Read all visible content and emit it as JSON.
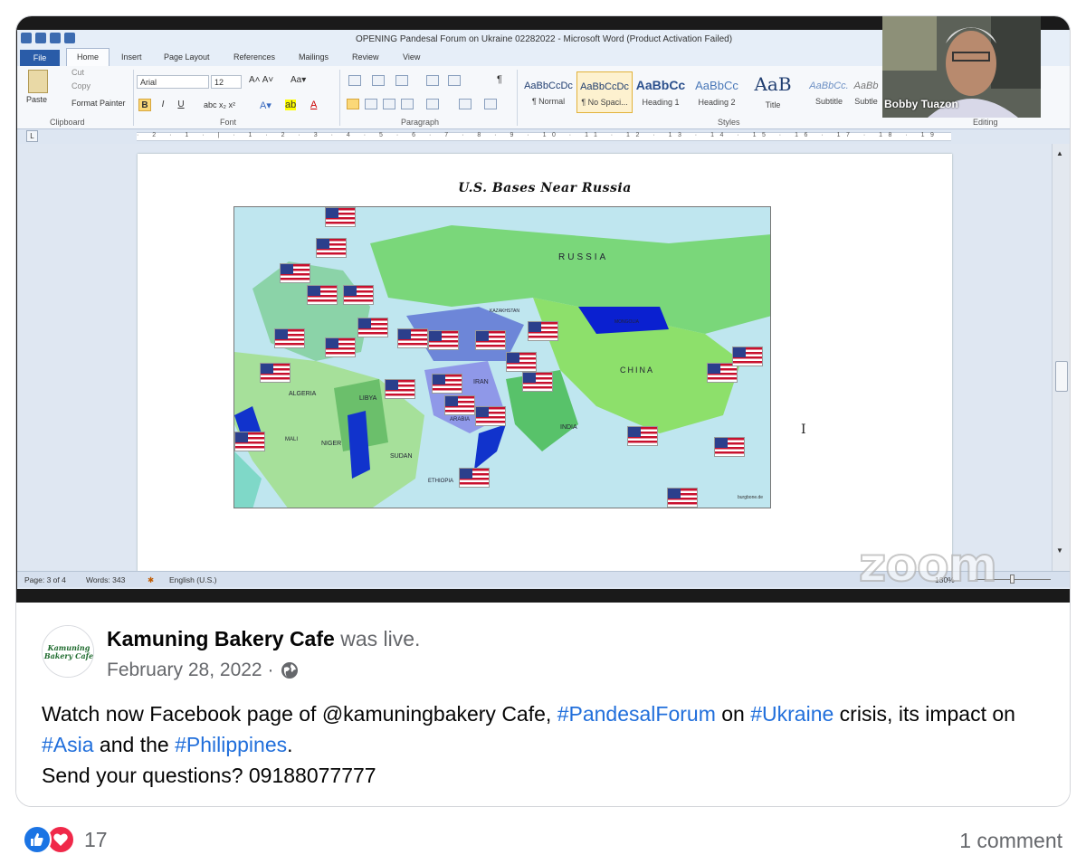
{
  "word": {
    "title": "OPENING Pandesal Forum on Ukraine 02282022  -  Microsoft Word (Product Activation Failed)",
    "tabs": [
      "File",
      "Home",
      "Insert",
      "Page Layout",
      "References",
      "Mailings",
      "Review",
      "View"
    ],
    "clipboard": {
      "paste": "Paste",
      "cut": "Cut",
      "copy": "Copy",
      "format_painter": "Format Painter",
      "label": "Clipboard"
    },
    "font": {
      "name": "Arial",
      "size": "12",
      "label": "Font",
      "bold": "B",
      "italic": "I",
      "underline": "U"
    },
    "paragraph_label": "Paragraph",
    "styles": [
      {
        "preview": "AaBbCcDc",
        "name": "¶ Normal"
      },
      {
        "preview": "AaBbCcDc",
        "name": "¶ No Spaci..."
      },
      {
        "preview": "AaBbCc",
        "name": "Heading 1"
      },
      {
        "preview": "AaBbCc",
        "name": "Heading 2"
      },
      {
        "preview": "AaB",
        "name": "Title"
      },
      {
        "preview": "AaBbCc.",
        "name": "Subtitle"
      },
      {
        "preview": "AaBb",
        "name": "Subtle"
      }
    ],
    "styles_label": "Styles",
    "editing_label": "Editing",
    "ruler_numbers": "· 2 · 1 · | · 1 · 2 · 3 · 4 · 5 · 6 · 7 · 8 · 9 · 10 · 11 · 12 · 13 · 14 · 15 · 16 · 17 · 18 · 19",
    "status": {
      "page": "Page: 3 of 4",
      "words": "Words: 343",
      "language": "English (U.S.)",
      "zoom": "130%"
    }
  },
  "map": {
    "title": "U.S. Bases Near Russia",
    "labels": {
      "russia": "RUSSIA",
      "china": "CHINA",
      "india": "INDIA",
      "iran": "IRAN",
      "algeria": "ALGERIA",
      "libya": "LIBYA",
      "niger": "NIGER",
      "sudan": "SUDAN",
      "mali": "MALI",
      "arabia": "ARABIA",
      "ethiopia": "ETHIOPIA",
      "kazakhstan": "KAZAKHSTAN",
      "mongolia": "MONGOLIA",
      "credit": "burgbone.de"
    }
  },
  "zoom": {
    "participant_name": "Bobby Tuazon",
    "watermark": "zoom"
  },
  "post": {
    "page_name": "Kamuning Bakery Cafe",
    "was_live": "was live.",
    "date": "February 28, 2022 ·",
    "avatar_text": "Kamuning Bakery Cafe",
    "text": {
      "p1": "Watch now Facebook page of @kamuningbakery Cafe, ",
      "tag1": "#PandesalForum",
      "p2": " on ",
      "tag2": "#Ukraine",
      "p3": " crisis, its impact on ",
      "tag3": "#Asia",
      "p4": " and the ",
      "tag4": "#Philippines",
      "p5": ".",
      "line3": "Send your questions? 09188077777"
    },
    "reaction_count": "17",
    "comment_count": "1 comment"
  },
  "colors": {
    "facebook_blue": "#216fdb",
    "like_blue": "#1b74e4",
    "love_red": "#f02849"
  }
}
